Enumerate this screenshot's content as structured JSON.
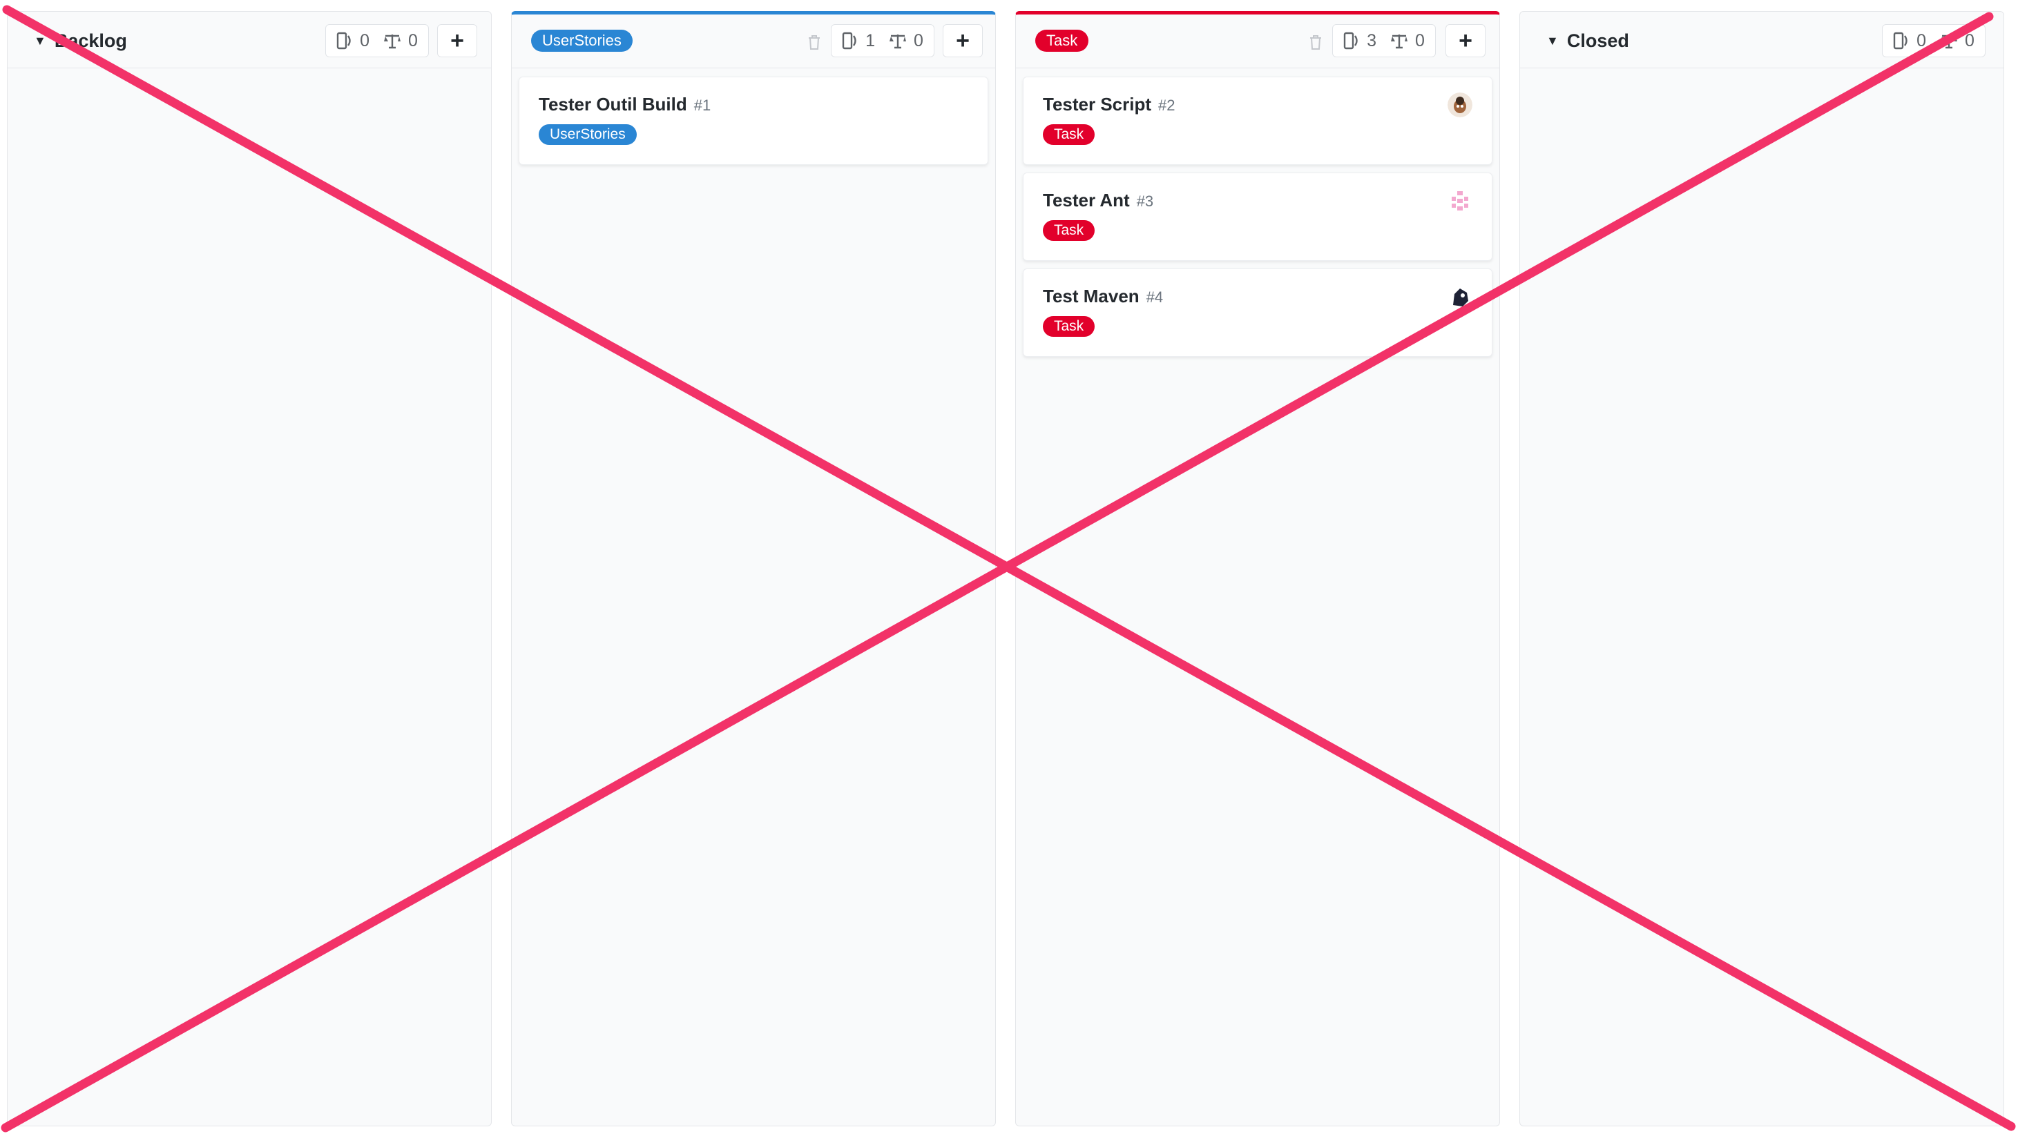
{
  "columns": [
    {
      "title": "Backlog",
      "issue_count": "0",
      "weight": "0",
      "add_label": "+",
      "cards": []
    },
    {
      "label": "UserStories",
      "issue_count": "1",
      "weight": "0",
      "add_label": "+",
      "cards": [
        {
          "title": "Tester Outil Build",
          "number": "#1",
          "label": "UserStories"
        }
      ]
    },
    {
      "label": "Task",
      "issue_count": "3",
      "weight": "0",
      "add_label": "+",
      "cards": [
        {
          "title": "Tester Script",
          "number": "#2",
          "label": "Task"
        },
        {
          "title": "Tester Ant",
          "number": "#3",
          "label": "Task"
        },
        {
          "title": "Test Maven",
          "number": "#4",
          "label": "Task"
        }
      ]
    },
    {
      "title": "Closed",
      "issue_count": "0",
      "weight": "0",
      "cards": []
    }
  ],
  "colors": {
    "userstories_label": "#2a86d4",
    "task_label": "#e2002b",
    "cross_out": "#f23268"
  },
  "icons": {
    "collapse": "caret-down-icon",
    "issues": "issues-icon",
    "weight": "weight-icon",
    "delete": "trash-icon",
    "add": "plus-icon"
  }
}
